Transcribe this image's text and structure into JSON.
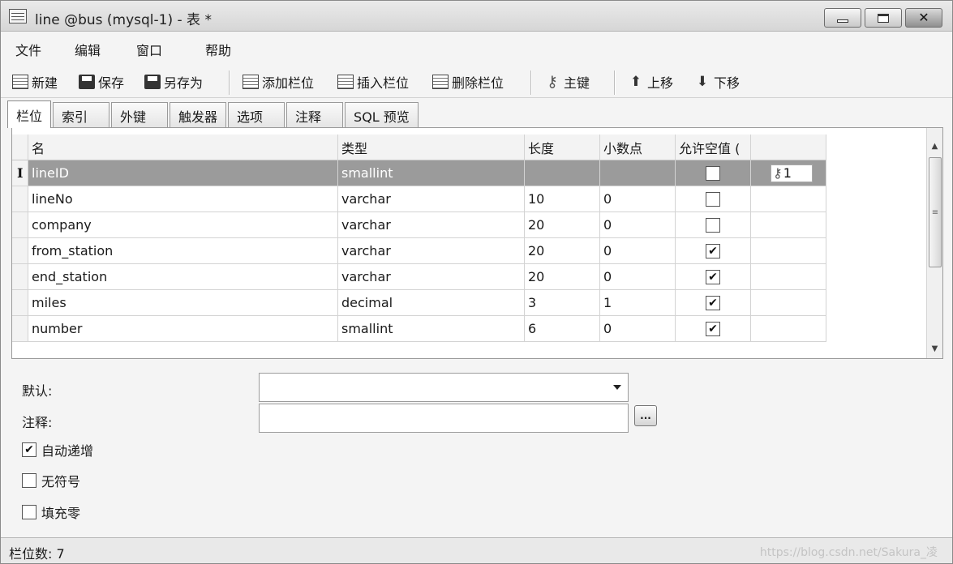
{
  "window": {
    "title": "line @bus (mysql-1) - 表 *"
  },
  "menu": [
    "文件",
    "编辑",
    "窗口",
    "帮助"
  ],
  "toolbar": {
    "new": "新建",
    "save": "保存",
    "save_as": "另存为",
    "add_field": "添加栏位",
    "insert_field": "插入栏位",
    "delete_field": "删除栏位",
    "primary_key": "主键",
    "move_up": "上移",
    "move_down": "下移"
  },
  "tabs": [
    "栏位",
    "索引",
    "外键",
    "触发器",
    "选项",
    "注释",
    "SQL 预览"
  ],
  "active_tab": "栏位",
  "grid": {
    "columns": [
      "名",
      "类型",
      "长度",
      "小数点",
      "允许空值 (",
      ""
    ],
    "rows": [
      {
        "name": "lineID",
        "type": "smallint",
        "length": "",
        "decimals": "",
        "allow_null": false,
        "key": "1",
        "selected": true
      },
      {
        "name": "lineNo",
        "type": "varchar",
        "length": "10",
        "decimals": "0",
        "allow_null": false,
        "key": ""
      },
      {
        "name": "company",
        "type": "varchar",
        "length": "20",
        "decimals": "0",
        "allow_null": false,
        "key": ""
      },
      {
        "name": "from_station",
        "type": "varchar",
        "length": "20",
        "decimals": "0",
        "allow_null": true,
        "key": ""
      },
      {
        "name": "end_station",
        "type": "varchar",
        "length": "20",
        "decimals": "0",
        "allow_null": true,
        "key": ""
      },
      {
        "name": "miles",
        "type": "decimal",
        "length": "3",
        "decimals": "1",
        "allow_null": true,
        "key": ""
      },
      {
        "name": "number",
        "type": "smallint",
        "length": "6",
        "decimals": "0",
        "allow_null": true,
        "key": ""
      }
    ],
    "row_indicator": "I"
  },
  "props": {
    "default_label": "默认:",
    "default_value": "",
    "comment_label": "注释:",
    "comment_value": "",
    "dots_label": "...",
    "auto_increment_label": "自动递增",
    "auto_increment": true,
    "unsigned_label": "无符号",
    "unsigned": false,
    "zerofill_label": "填充零",
    "zerofill": false
  },
  "status": {
    "field_count": "栏位数: 7",
    "watermark": "https://blog.csdn.net/Sakura_凌"
  }
}
